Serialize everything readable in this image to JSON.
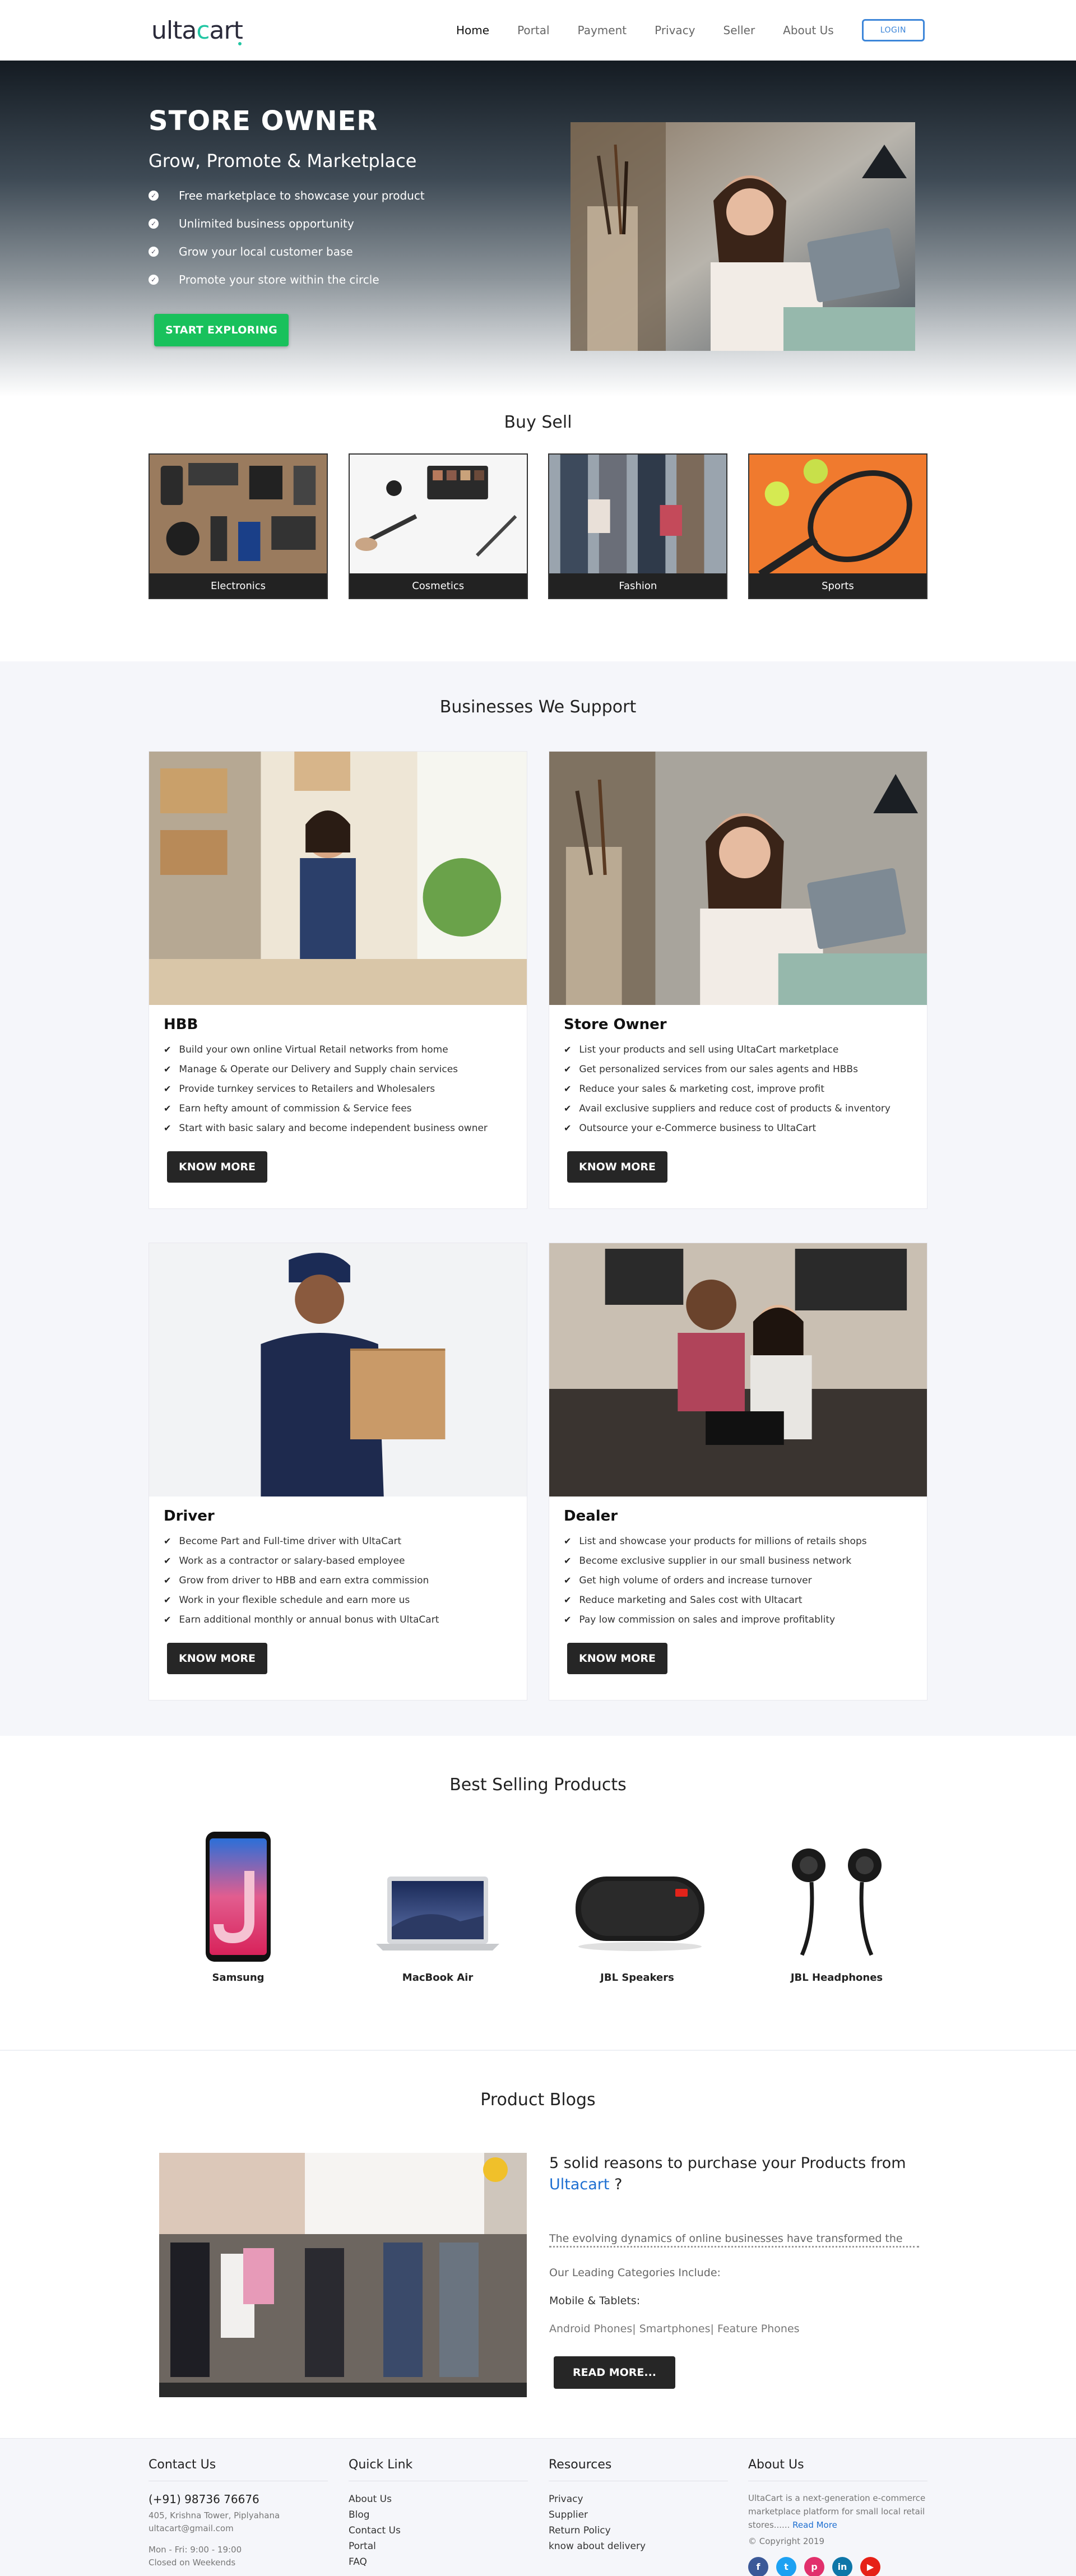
{
  "nav": {
    "logo": "ultacart",
    "items": [
      {
        "label": "Home",
        "active": true
      },
      {
        "label": "Portal"
      },
      {
        "label": "Payment"
      },
      {
        "label": "Privacy"
      },
      {
        "label": "Seller"
      },
      {
        "label": "About Us"
      }
    ],
    "login": "LOGIN"
  },
  "hero": {
    "title": "STORE OWNER",
    "subtitle": "Grow, Promote & Marketplace",
    "bullets": [
      "Free marketplace to showcase your product",
      "Unlimited business opportunity",
      "Grow your local customer base",
      "Promote your store within the circle"
    ],
    "cta": "START EXPLORING"
  },
  "buysell": {
    "title": "Buy Sell",
    "categories": [
      "Electronics",
      "Cosmetics",
      "Fashion",
      "Sports"
    ]
  },
  "businesses": {
    "title": "Businesses We Support",
    "cards": [
      {
        "title": "HBB",
        "items": [
          "Build your own online Virtual Retail networks from home",
          "Manage & Operate our Delivery and Supply chain services",
          "Provide turnkey services to Retailers and Wholesalers",
          "Earn hefty amount of commission & Service fees",
          "Start with basic salary and become independent business owner"
        ],
        "button": "KNOW MORE"
      },
      {
        "title": "Store Owner",
        "items": [
          "List your products and sell using UltaCart marketplace",
          "Get personalized services from our sales agents and HBBs",
          "Reduce your sales & marketing cost, improve profit",
          "Avail exclusive suppliers and reduce cost of products & inventory",
          "Outsource your e-Commerce business to UltaCart"
        ],
        "button": "KNOW MORE"
      },
      {
        "title": "Driver",
        "items": [
          "Become Part and Full-time driver with UltaCart",
          "Work as a contractor or salary-based employee",
          "Grow from driver to HBB and earn extra commission",
          "Work in your flexible schedule and earn more us",
          "Earn additional monthly or annual bonus with UltaCart"
        ],
        "button": "KNOW MORE"
      },
      {
        "title": "Dealer",
        "items": [
          "List and showcase your products for millions of retails shops",
          "Become exclusive supplier in our small business network",
          "Get high volume of orders and increase turnover",
          "Reduce marketing and Sales cost with Ultacart",
          "Pay low commission on sales and improve profitablity"
        ],
        "button": "KNOW MORE"
      }
    ]
  },
  "best": {
    "title": "Best Selling Products",
    "products": [
      "Samsung",
      "MacBook Air",
      "JBL Speakers",
      "JBL Headphones"
    ]
  },
  "blogs": {
    "title": "Product Blogs",
    "post_title": "5 solid reasons to purchase your Products from",
    "post_link": "Ultacart",
    "post_q": " ?",
    "excerpt": "The evolving dynamics of online businesses have transformed the",
    "categories": "Our Leading Categories Include:",
    "mobile": "Mobile & Tablets:",
    "phones": "Android Phones| Smartphones| Feature Phones",
    "button": "READ MORE..."
  },
  "footer": {
    "contact": {
      "title": "Contact Us",
      "phone": "(+91) 98736 76676",
      "address": "405, Krishna Tower, Piplyahana",
      "email": "ultacart@gmail.com",
      "hours": "Mon - Fri: 9:00 - 19:00",
      "closed": "Closed on Weekends"
    },
    "quick": {
      "title": "Quick Link",
      "links": [
        "About Us",
        "Blog",
        "Contact Us",
        "Portal",
        "FAQ"
      ]
    },
    "resources": {
      "title": "Resources",
      "links": [
        "Privacy",
        "Supplier",
        "Return Policy",
        "know about delivery"
      ]
    },
    "about": {
      "title": "About Us",
      "text": "UltaCart is a next-generation e-commerce marketplace platform for small local retail stores......",
      "read_more": "Read More",
      "copyright": "© Copyright 2019"
    },
    "social_colors": [
      "#3b5998",
      "#1da1f2",
      "#e1306c",
      "#0e76a8",
      "#e62117"
    ]
  }
}
